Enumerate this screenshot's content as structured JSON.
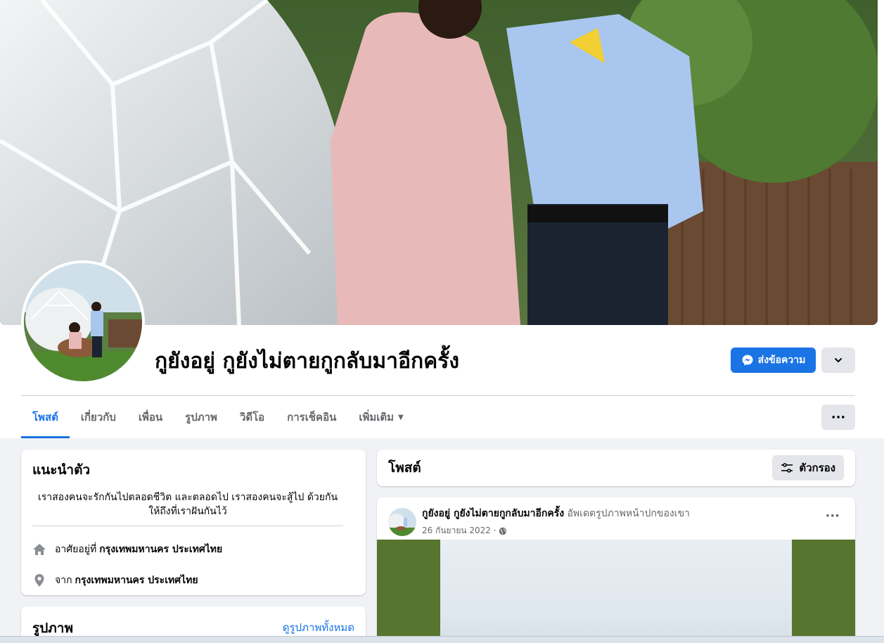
{
  "profile": {
    "name": "กูยังอยู่ กูยังไม่ตายกูกลับมาอีกครั้ง"
  },
  "actions": {
    "message_label": "ส่งข้อความ",
    "more_label": "···"
  },
  "tabs": [
    {
      "label": "โพสต์",
      "active": true
    },
    {
      "label": "เกี่ยวกับ"
    },
    {
      "label": "เพื่อน"
    },
    {
      "label": "รูปภาพ"
    },
    {
      "label": "วิดีโอ"
    },
    {
      "label": "การเช็คอิน"
    },
    {
      "label": "เพิ่มเติม",
      "caret": "▼"
    }
  ],
  "intro": {
    "title": "แนะนำตัว",
    "bio": "เราสองคนจะรักกันไปตลอดชีวิต และตลอดไป เราสองคนจะสู้ไป ด้วยกัน ให้ถึงที่เราฝันกันไว้",
    "lives_in_prefix": "อาศัยอยู่ที่",
    "lives_in_value": "กรุงเทพมหานคร ประเทศไทย",
    "from_prefix": "จาก",
    "from_value": "กรุงเทพมหานคร ประเทศไทย"
  },
  "photos": {
    "title": "รูปภาพ",
    "see_all": "ดูรูปภาพทั้งหมด"
  },
  "posts": {
    "title": "โพสต์",
    "filter_label": "ตัวกรอง"
  },
  "post": {
    "author": "กูยังอยู่ กูยังไม่ตายกูกลับมาอีกครั้ง",
    "action": "อัพเดตรูปภาพหน้าปกของเขา",
    "date": "26 กันยายน 2022 ·",
    "more": "···"
  },
  "colors": {
    "accent": "#1b74e4",
    "background": "#f0f2f5",
    "secondary_button": "#e4e6eb"
  },
  "icons": [
    "messenger-icon",
    "chevron-down-icon",
    "home-icon",
    "location-pin-icon",
    "filter-icon",
    "globe-icon"
  ]
}
